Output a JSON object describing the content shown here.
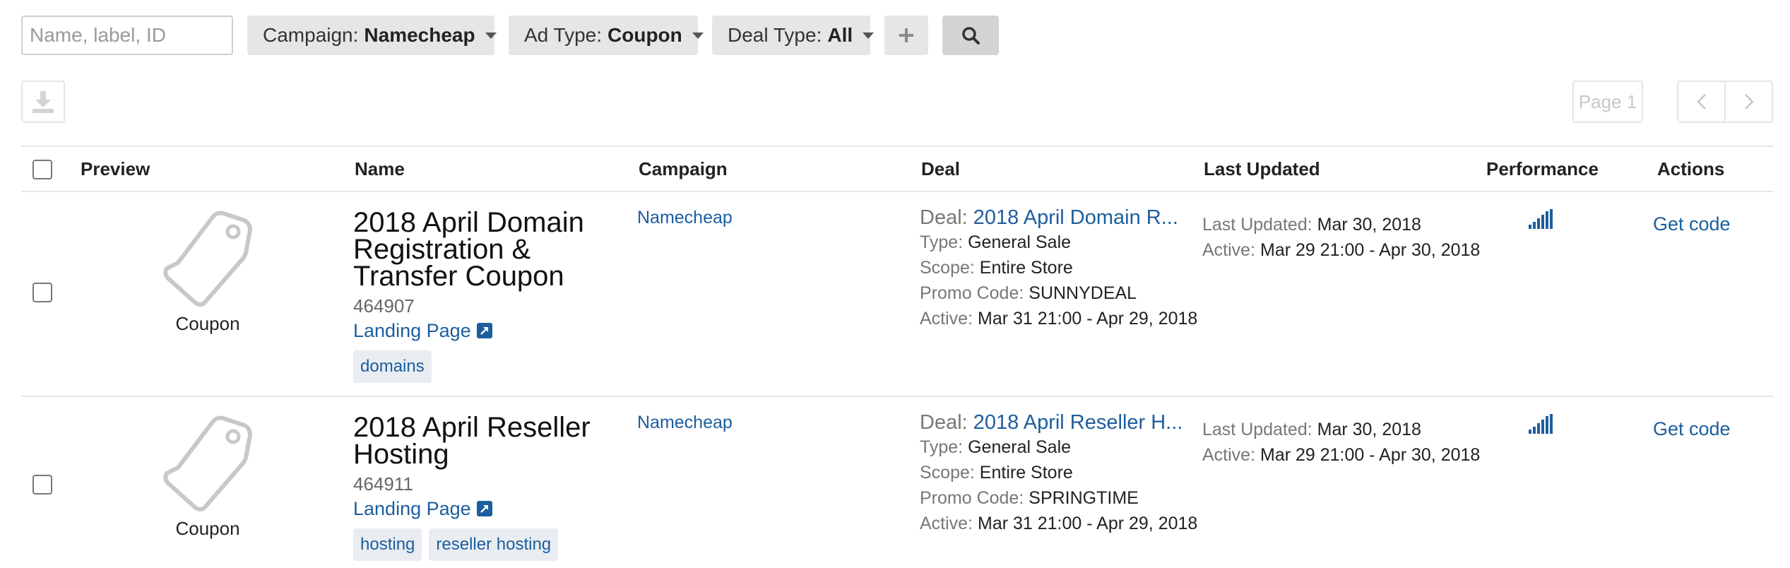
{
  "filters": {
    "search_placeholder": "Name, label, ID",
    "campaign_label": "Campaign:",
    "campaign_value": "Namecheap",
    "adtype_label": "Ad Type:",
    "adtype_value": "Coupon",
    "dealtype_label": "Deal Type:",
    "dealtype_value": "All"
  },
  "toolbar": {
    "page_label": "Page 1"
  },
  "table": {
    "headers": {
      "preview": "Preview",
      "name": "Name",
      "campaign": "Campaign",
      "deal": "Deal",
      "last_updated": "Last Updated",
      "performance": "Performance",
      "actions": "Actions"
    },
    "rows": [
      {
        "preview_label": "Coupon",
        "title_lines": [
          "2018 April Domain",
          "Registration &",
          "Transfer Coupon"
        ],
        "id": "464907",
        "landing_page": "Landing Page",
        "tags": [
          "domains"
        ],
        "campaign": "Namecheap",
        "deal_label": "Deal:",
        "deal_name": "2018 April Domain R...",
        "type_label": "Type",
        "type_value": "General Sale",
        "scope_label": "Scope",
        "scope_value": "Entire Store",
        "promo_label": "Promo Code",
        "promo_value": "SUNNYDEAL",
        "active_label": "Active",
        "active_value": "Mar 31 21:00 - Apr 29, 2018",
        "updated_label": "Last Updated",
        "updated_value": "Mar 30, 2018",
        "upd_active_label": "Active",
        "upd_active_value": "Mar 29 21:00 - Apr 30, 2018",
        "action": "Get code"
      },
      {
        "preview_label": "Coupon",
        "title_lines": [
          "2018 April Reseller",
          "Hosting"
        ],
        "id": "464911",
        "landing_page": "Landing Page",
        "tags": [
          "hosting",
          "reseller hosting"
        ],
        "campaign": "Namecheap",
        "deal_label": "Deal:",
        "deal_name": "2018 April Reseller H...",
        "type_label": "Type",
        "type_value": "General Sale",
        "scope_label": "Scope",
        "scope_value": "Entire Store",
        "promo_label": "Promo Code",
        "promo_value": "SPRINGTIME",
        "active_label": "Active",
        "active_value": "Mar 31 21:00 - Apr 29, 2018",
        "updated_label": "Last Updated",
        "updated_value": "Mar 30, 2018",
        "upd_active_label": "Active",
        "upd_active_value": "Mar 29 21:00 - Apr 30, 2018",
        "action": "Get code"
      }
    ]
  },
  "colors": {
    "link": "#1d5e9e",
    "button_bg": "#e6e6e6",
    "search_btn_bg": "#d4d4d4"
  }
}
